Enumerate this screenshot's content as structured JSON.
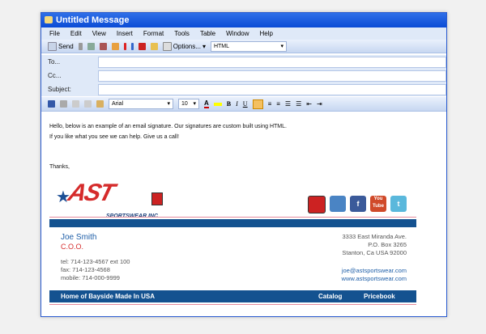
{
  "window": {
    "title": "Untitled Message"
  },
  "menu": [
    "File",
    "Edit",
    "View",
    "Insert",
    "Format",
    "Tools",
    "Table",
    "Window",
    "Help"
  ],
  "toolbar": {
    "send": "Send",
    "options": "Options...",
    "format": "HTML"
  },
  "fields": {
    "to": "To...",
    "cc": "Cc...",
    "subject": "Subject:"
  },
  "formatting": {
    "font": "Arial",
    "size": "10",
    "bold": "B",
    "italic": "I",
    "underline": "U"
  },
  "body": {
    "line1": "Hello, below is an example of an email signature. Our signatures are custom built using HTML.",
    "line2": "If you like what you see we can help. Give us a call!",
    "closing": "Thanks,"
  },
  "signature": {
    "logo_text": "AST",
    "logo_sub": "SPORTSWEAR INC",
    "social": [
      {
        "icon": "bayside-icon",
        "label": ""
      },
      {
        "icon": "mail-icon",
        "label": ""
      },
      {
        "icon": "facebook-icon",
        "label": "f"
      },
      {
        "icon": "youtube-icon",
        "label": "You Tube"
      },
      {
        "icon": "twitter-icon",
        "label": "t"
      }
    ],
    "name": "Joe Smith",
    "title": "C.O.O.",
    "tel": "tel: 714-123-4567 ext 100",
    "fax": "fax: 714-123-4568",
    "mobile": "mobile: 714-000-9999",
    "address1": "3333 East Miranda Ave.",
    "address2": "P.O. Box 3265",
    "address3": "Stanton, Ca USA 92000",
    "email": "joe@astsportswear.com",
    "website": "www.astsportswear.com",
    "tagline": "Home of Bayside Made In USA",
    "catalog": "Catalog",
    "pricebook": "Pricebook",
    "colors": {
      "blue": "#145290",
      "red": "#d52b2b",
      "name": "#1f5fa8"
    }
  }
}
